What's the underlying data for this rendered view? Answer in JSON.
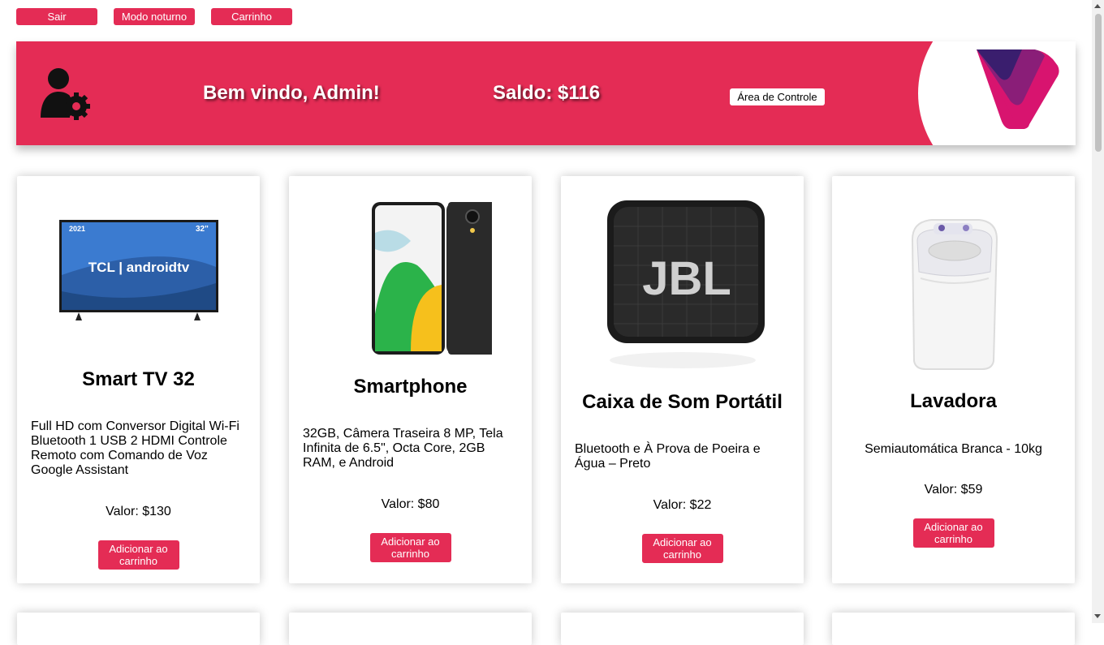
{
  "topbar": {
    "logout_label": "Sair",
    "dark_mode_label": "Modo noturno",
    "cart_label": "Carrinho"
  },
  "header": {
    "welcome": "Bem vindo, Admin!",
    "balance": "Saldo: $116",
    "control_area_label": "Área de Controle"
  },
  "products": [
    {
      "name": "Smart TV 32",
      "description": "Full HD com Conversor Digital Wi-Fi Bluetooth 1 USB 2 HDMI Controle Remoto com Comando de Voz Google Assistant",
      "price": "Valor: $130",
      "button": "Adicionar ao carrinho",
      "image_badge_year": "2021",
      "image_badge_size": "32\"",
      "image_brand": "TCL | androidtv"
    },
    {
      "name": "Smartphone",
      "description": "32GB, Câmera Traseira 8 MP, Tela Infinita de 6.5\", Octa Core, 2GB RAM, e Android",
      "price": "Valor: $80",
      "button": "Adicionar ao carrinho"
    },
    {
      "name": "Caixa de Som Portátil",
      "description": "Bluetooth e À Prova de Poeira e Água – Preto",
      "price": "Valor: $22",
      "button": "Adicionar ao carrinho",
      "image_brand": "JBL"
    },
    {
      "name": "Lavadora",
      "description": "Semiautomática Branca - 10kg",
      "price": "Valor: $59",
      "button": "Adicionar ao carrinho"
    }
  ],
  "colors": {
    "accent": "#e42c55",
    "logo_dark": "#3a1e6e",
    "logo_mid": "#8a1e78",
    "logo_light": "#d8146f"
  }
}
